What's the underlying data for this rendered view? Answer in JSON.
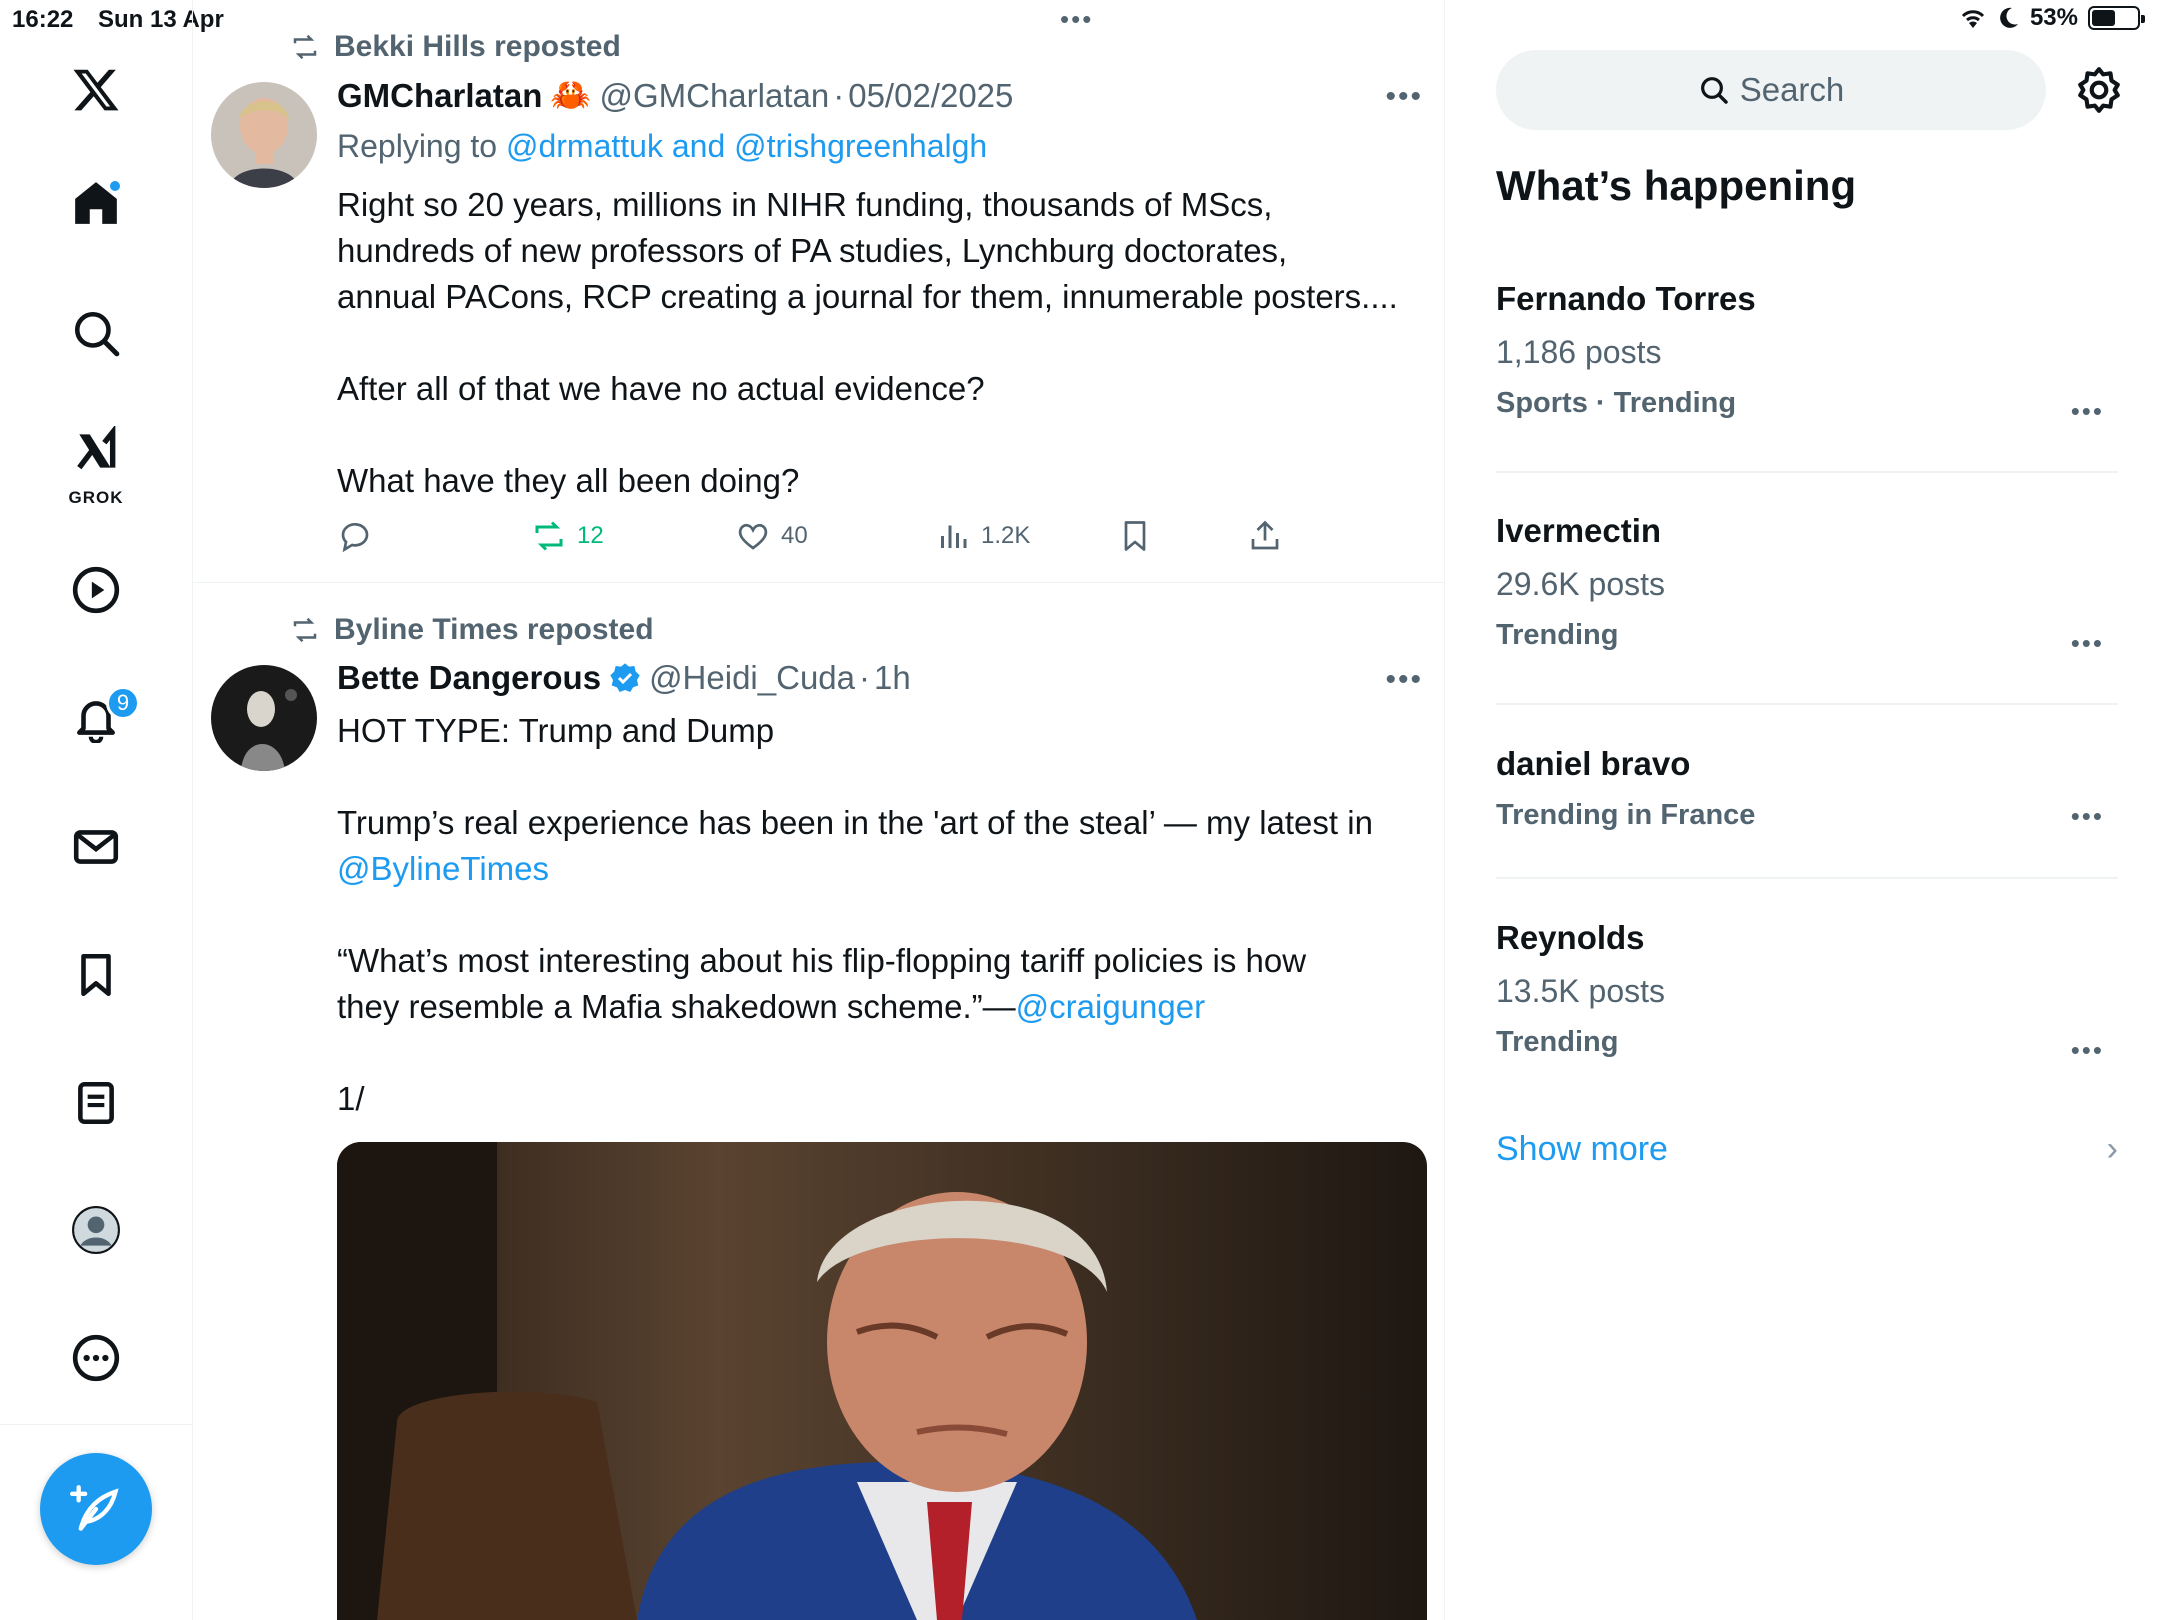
{
  "status_bar": {
    "time": "16:22",
    "date": "Sun 13 Apr",
    "battery": "53%",
    "battery_level": 0.53
  },
  "nav": {
    "grok_label": "GROK",
    "notifications_badge": "9",
    "items": [
      "x-logo-icon",
      "home-icon",
      "search-icon",
      "grok-icon",
      "video-icon",
      "bell-icon",
      "mail-icon",
      "bookmark-icon",
      "lists-icon",
      "profile-icon",
      "more-icon"
    ]
  },
  "feed": {
    "tweets": [
      {
        "repost_by": "Bekki Hills reposted",
        "name": "GMCharlatan",
        "emoji": "🦀",
        "handle": "@GMCharlatan",
        "date": "05/02/2025",
        "replying_prefix": "Replying to ",
        "replying_to": "@drmattuk and @trishgreenhalgh",
        "text_lines": [
          "Right so 20 years, millions in NIHR funding, thousands of MScs,",
          "hundreds of new professors of PA studies, Lynchburg doctorates,",
          "annual PACons, RCP creating a journal for them, innumerable posters....",
          "",
          "After all of that we have no actual evidence?",
          "",
          "What have they all been doing?"
        ],
        "reposts": "12",
        "likes": "40",
        "views": "1.2K"
      },
      {
        "repost_by": "Byline Times reposted",
        "name": "Bette Dangerous",
        "handle": "@Heidi_Cuda",
        "time": "1h",
        "headline": "HOT TYPE: Trump and Dump",
        "para1": "Trump’s real experience has been in the 'art of the steal’ — my latest in",
        "para1_link": "@BylineTimes",
        "para2_line1": "“What’s most interesting about his flip-flopping tariff policies is how",
        "para2_line2": "they resemble a Mafia shakedown scheme.”—",
        "para2_link": "@craigunger",
        "para3": "1/"
      }
    ]
  },
  "sidebar": {
    "search_placeholder": "Search",
    "section_title": "What’s happening",
    "trends": [
      {
        "name": "Fernando Torres",
        "posts": "1,186 posts",
        "meta": "Sports · Trending"
      },
      {
        "name": "Ivermectin",
        "posts": "29.6K posts",
        "meta": "Trending"
      },
      {
        "name": "daniel bravo",
        "posts": "",
        "meta": "Trending in France"
      },
      {
        "name": "Reynolds",
        "posts": "13.5K posts",
        "meta": "Trending"
      }
    ],
    "show_more": "Show more"
  },
  "colors": {
    "accent": "#1d9bf0",
    "secondary_text": "#536471",
    "repost_green": "#00ba7c",
    "divider": "#eff3f4"
  }
}
